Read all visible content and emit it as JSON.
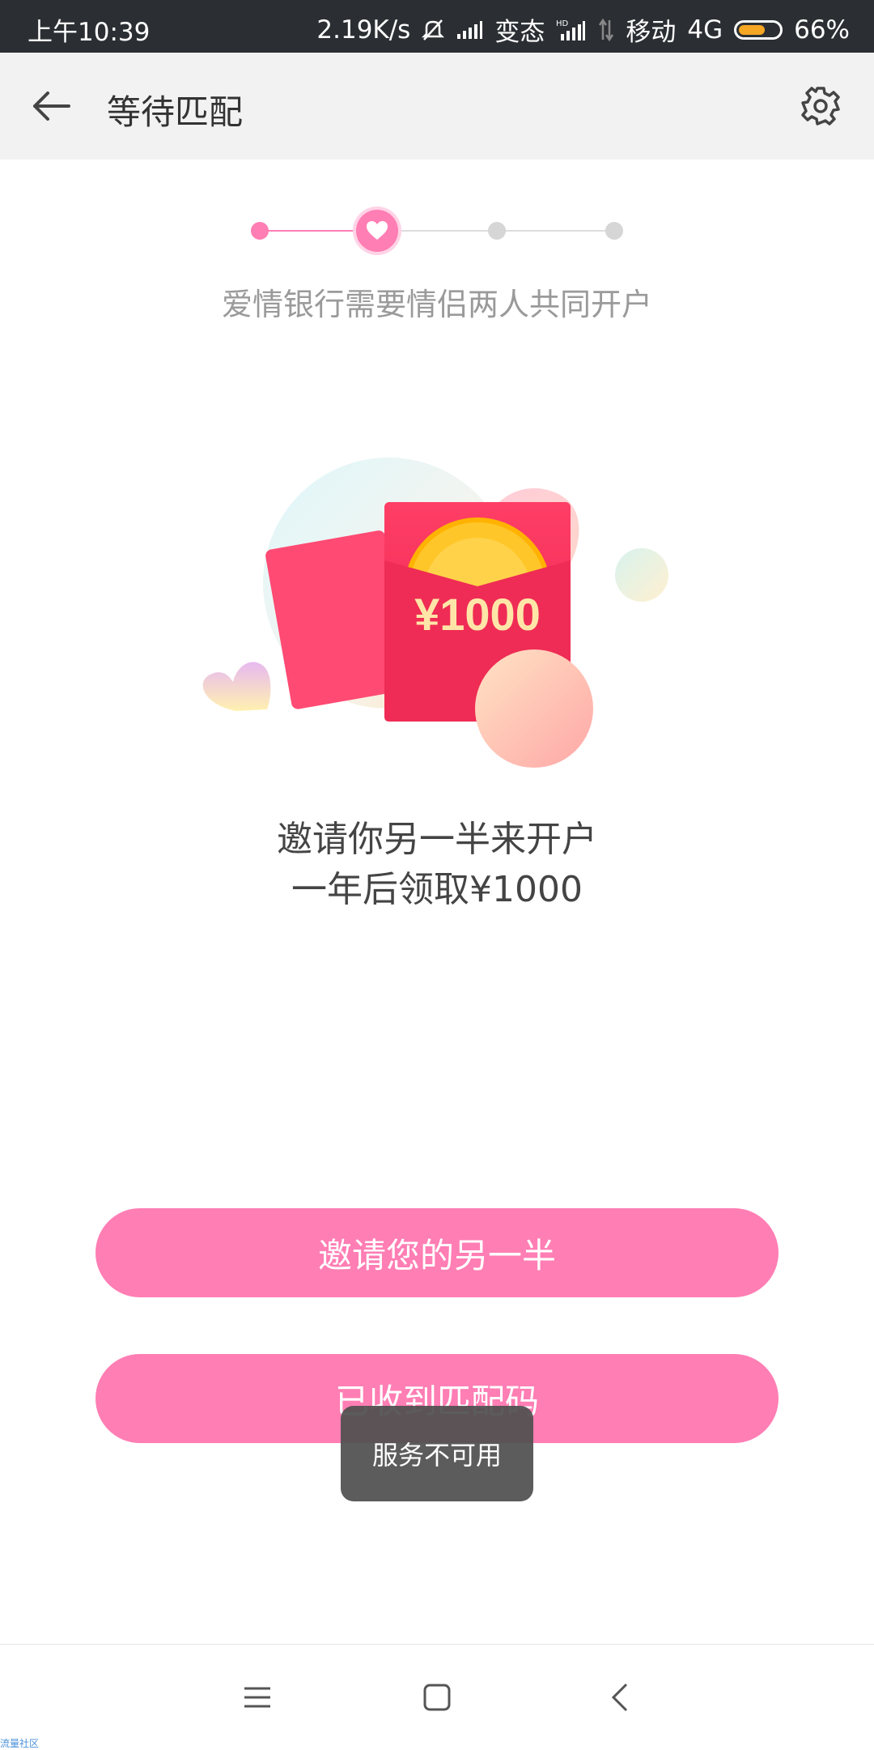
{
  "status_bar": {
    "time": "上午10:39",
    "net_speed": "2.19K/s",
    "volte": "变态",
    "carrier": "移动",
    "network": "4G",
    "battery": "66%",
    "battery_level": 0.66,
    "icons": [
      "mute-bell-icon",
      "signal-icon",
      "hd-signal-icon",
      "data-arrows-icon",
      "battery-icon"
    ]
  },
  "header": {
    "title": "等待匹配",
    "back_icon": "arrow-left-icon",
    "settings_icon": "gear-icon"
  },
  "stepper": {
    "current_step": 2,
    "total_steps": 4,
    "active_color": "#ff7eb4",
    "inactive_color": "#d6d6d6"
  },
  "subtitle": "爱情银行需要情侣两人共同开户",
  "illustration": {
    "amount_text": "¥1000"
  },
  "promo": {
    "line1": "邀请你另一半来开户",
    "line2": "一年后领取¥1000"
  },
  "buttons": {
    "invite": "邀请您的另一半",
    "received_code": "已收到匹配码"
  },
  "toast": "服务不可用",
  "nav": {
    "menu_icon": "menu-icon",
    "home_icon": "home-square-icon",
    "back_icon": "back-chevron-icon"
  },
  "watermark": "流量社区",
  "colors": {
    "accent": "#ff7eb4",
    "status_bar": "#2b2f33",
    "header_bg": "#f2f2f2"
  }
}
